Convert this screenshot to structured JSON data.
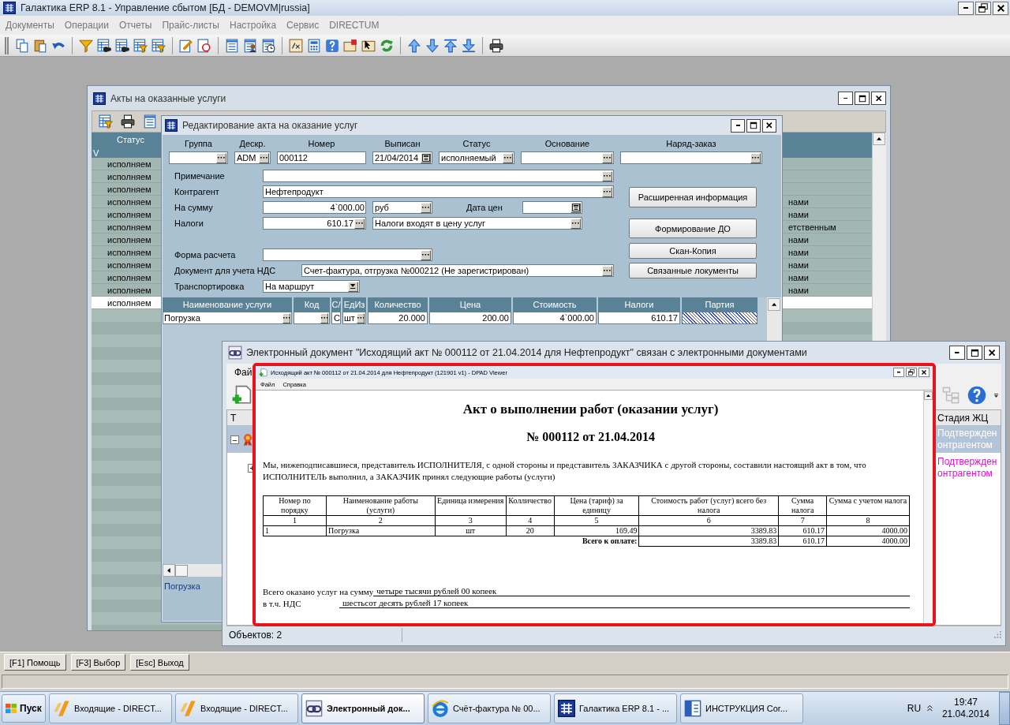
{
  "app": {
    "title": "Галактика ERP 8.1 - Управление сбытом [БД - DEMOVM|russia]",
    "menu": [
      "Документы",
      "Операции",
      "Отчеты",
      "Прайс-листы",
      "Настройка",
      "Сервис",
      "DIRECTUM"
    ]
  },
  "acts_window": {
    "title": "Акты на оказанные услуги",
    "columns": [
      "V",
      "Статус"
    ],
    "rows": [
      {
        "status": "исполняем",
        "selected": false
      },
      {
        "status": "исполняем",
        "selected": false
      },
      {
        "status": "исполняем",
        "selected": false
      },
      {
        "status": "исполняем",
        "column_3": "нами",
        "selected": false
      },
      {
        "status": "исполняем",
        "column_3": "нами",
        "selected": false
      },
      {
        "status": "исполняем",
        "column_3": "етственным",
        "selected": false
      },
      {
        "status": "исполняем",
        "column_3": "нами",
        "selected": false
      },
      {
        "status": "исполняем",
        "column_3": "нами",
        "selected": false
      },
      {
        "status": "исполняем",
        "column_3": "нами",
        "selected": false
      },
      {
        "status": "исполняем",
        "column_3": "нами",
        "selected": false
      },
      {
        "status": "исполняем",
        "column_3": "нами",
        "selected": false
      },
      {
        "status": "исполняем",
        "selected": true
      }
    ]
  },
  "edit_window": {
    "title": "Редактирование акта на оказание услуг",
    "header_fields": [
      {
        "label": "Группа",
        "kind": "lookup"
      },
      {
        "label": "Дескр.",
        "value": "ADM",
        "kind": "lookup"
      },
      {
        "label": "Номер",
        "value": "000112",
        "kind": "text"
      },
      {
        "label": "Выписан",
        "value": "21/04/2014",
        "kind": "date"
      },
      {
        "label": "Статус",
        "value": "исполняемый",
        "kind": "lookup"
      },
      {
        "label": "Основание",
        "kind": "lookup"
      },
      {
        "label": "Наряд-заказ",
        "kind": "lookup"
      }
    ],
    "note": {
      "label": "Примечание"
    },
    "counterparty": {
      "label": "Контрагент",
      "value": "Нефтепродукт"
    },
    "amount": {
      "label": "На сумму",
      "value": "4`000.00",
      "currency": "руб",
      "price_date_label": "Дата цен"
    },
    "taxes": {
      "label": "Налоги",
      "value": "610.17",
      "mode": "Налоги входят в цену услуг"
    },
    "payment_form": {
      "label": "Форма расчета"
    },
    "vat_document": {
      "label": "Документ для учета НДС",
      "value": "Счет-фактура, отгрузка №000212 (Не зарегистрирован)"
    },
    "transport": {
      "label": "Транспортировка",
      "value": "На маршрут"
    },
    "buttons": [
      "Расширенная информация",
      "Формирование ДО",
      "Скан-Копия",
      "Связанные локументы"
    ],
    "table": {
      "columns": [
        "Наименование услуги",
        "Код",
        "С/",
        "ЕдИз",
        "Количество",
        "Цена",
        "Стоимость",
        "Налоги",
        "Партия"
      ],
      "rows": [
        {
          "cells": [
            {
              "text": "Погрузка",
              "kind": "lookup"
            },
            {
              "kind": "lookup"
            },
            {
              "text": "С",
              "kind": "text"
            },
            {
              "text": "шт",
              "kind": "lookup"
            },
            {
              "text": "20.000",
              "kind": "number"
            },
            {
              "text": "200.00",
              "kind": "number"
            },
            {
              "text": "4`000.00",
              "kind": "number"
            },
            {
              "text": "610.17",
              "kind": "number"
            },
            {
              "kind": "hatched"
            }
          ]
        }
      ]
    },
    "footer": "Погрузка"
  },
  "edoc_window": {
    "title": "Электронный документ \"Исходящий акт № 000112 от 21.04.2014 для Нефтепродукт\" связан с электронными документами",
    "menu": [
      "Фай"
    ],
    "columns": [
      "Т",
      "Стадия ЖЦ"
    ],
    "rows": [
      {
        "expander": "–",
        "stage": [
          "Подтвержден",
          "онтрагентом"
        ],
        "selected": true,
        "children": [
          {
            "expander": "+",
            "stage": [
              "Подтвержден",
              "онтрагентом"
            ],
            "selected": false
          }
        ]
      }
    ],
    "status": "Объектов: 2"
  },
  "viewer": {
    "title": "Исходящий акт № 000112 от 21.04.2014 для Нефтепродукт (121901 v1) - DPAD Viewer",
    "menu": [
      "Файл",
      "Справка"
    ],
    "document": {
      "heading": "Акт о выполнении работ (оказании услуг)",
      "number": "№ 000112 от 21.04.2014",
      "intro": "Мы, нижеподписавшиеся, представитель ИСПОЛНИТЕЛЯ, с одной стороны и представитель ЗАКАЗЧИКА с другой стороны, составили настоящий акт в том, что ИСПОЛНИТЕЛЬ выполнил, а ЗАКАЗЧИК принял следующие работы (услуги)",
      "columns": [
        "Номер по порядку",
        "Наименование работы (услуги)",
        "Единица измерения",
        "Колличество",
        "Цена (тариф) за единицу",
        "Стоимость работ (услуг) всего без налога",
        "Сумма налога",
        "Сумма с учетом налога"
      ],
      "column_numbers": [
        "1",
        "2",
        "3",
        "4",
        "5",
        "6",
        "7",
        "8"
      ],
      "rows": [
        [
          "1",
          "Погрузка",
          "шт",
          "20",
          "169.49",
          "3389.83",
          "610.17",
          "4000.00"
        ]
      ],
      "total_label": "Всего к оплате:",
      "totals": [
        "3389.83",
        "610.17",
        "4000.00"
      ],
      "sum_label": "Всего оказано услуг на сумму",
      "sum_words": "четыре тысячи рублей 00 копеек",
      "vat_label": "в т.ч. НДС",
      "vat_words": "шестьсот десять рублей 17 копеек"
    }
  },
  "fkeys": [
    "[F1] Помощь",
    "[F3] Выбор",
    "[Esc] Выход"
  ],
  "taskbar": {
    "start": "Пуск",
    "items": [
      {
        "label": "Входящие - DIRECT...",
        "kind": "directum",
        "selected": false
      },
      {
        "label": "Входящие - DIRECT...",
        "kind": "directum",
        "selected": false
      },
      {
        "label": "Электронный док...",
        "kind": "link",
        "selected": true
      },
      {
        "label": "Счёт-фактура № 00...",
        "kind": "browser",
        "selected": false
      },
      {
        "label": "Галактика ERP 8.1 - ...",
        "kind": "erp",
        "selected": false
      },
      {
        "label": "ИНСТРУКЦИЯ Cor...",
        "kind": "word",
        "selected": false
      }
    ],
    "language": "RU",
    "time": "19:47",
    "date": "21.04.2014"
  }
}
